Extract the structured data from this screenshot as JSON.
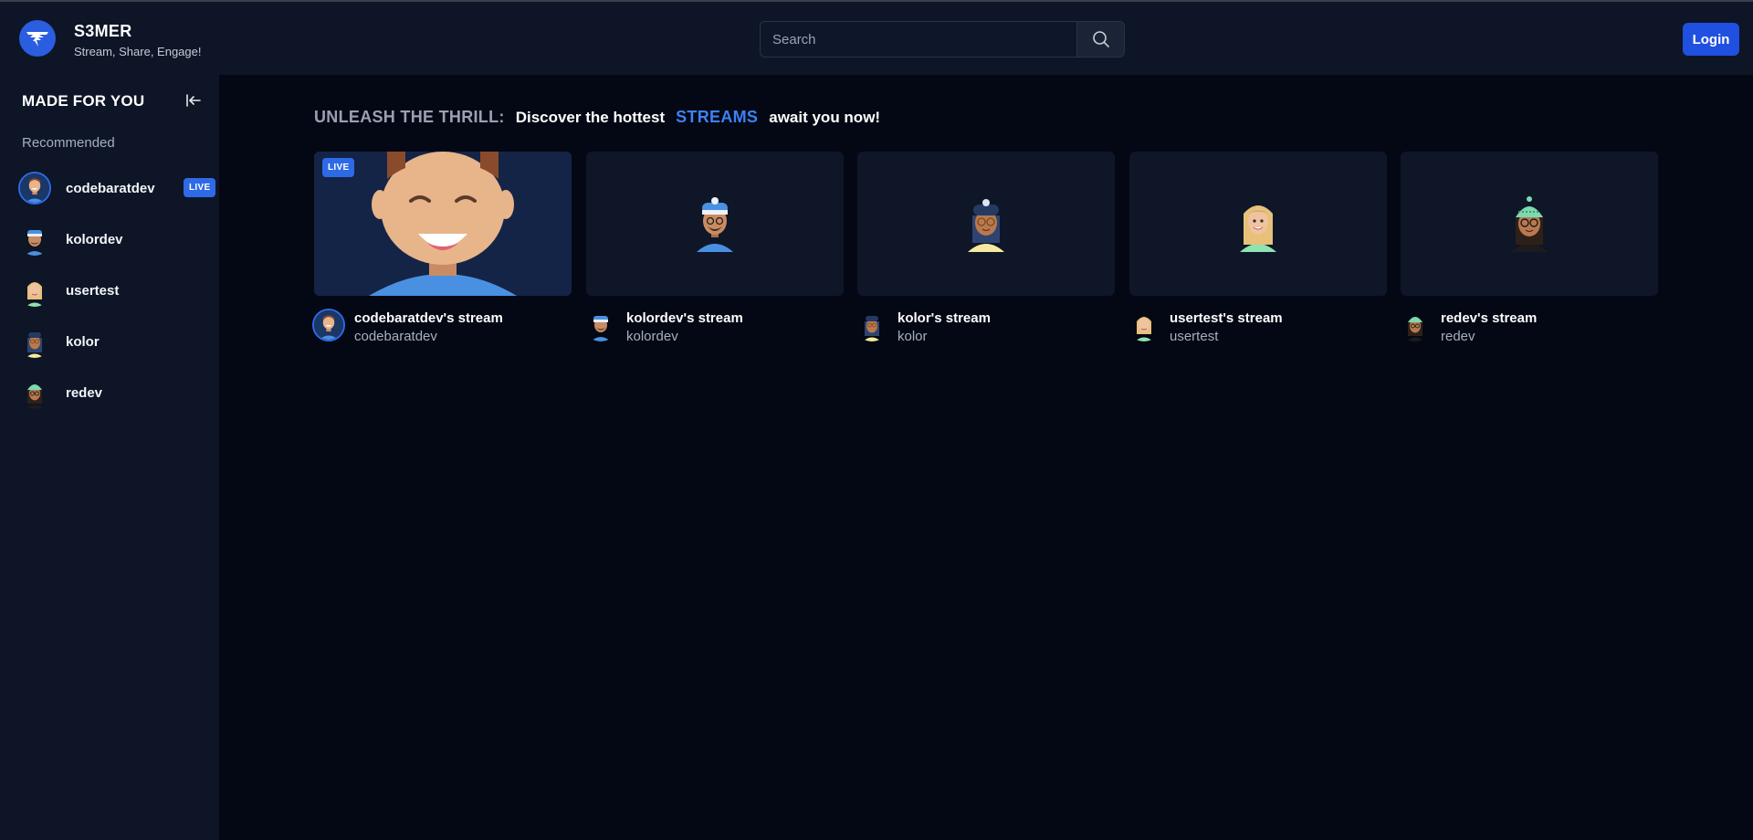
{
  "app": {
    "title": "S3MER",
    "tagline": "Stream, Share, Engage!"
  },
  "search": {
    "placeholder": "Search"
  },
  "header": {
    "login_label": "Login"
  },
  "sidebar": {
    "title": "MADE FOR YOU",
    "section_label": "Recommended",
    "live_badge": "LIVE",
    "items": [
      {
        "label": "codebaratdev",
        "live": true
      },
      {
        "label": "kolordev",
        "live": false
      },
      {
        "label": "usertest",
        "live": false
      },
      {
        "label": "kolor",
        "live": false
      },
      {
        "label": "redev",
        "live": false
      }
    ]
  },
  "hero": {
    "part1": "UNLEASH THE THRILL:",
    "part2": "Discover the hottest",
    "part3": "STREAMS",
    "part4": "await you now!"
  },
  "streams": [
    {
      "title": "codebaratdev's stream",
      "user": "codebaratdev",
      "live": true,
      "live_label": "LIVE"
    },
    {
      "title": "kolordev's stream",
      "user": "kolordev",
      "live": false
    },
    {
      "title": "kolor's stream",
      "user": "kolor",
      "live": false
    },
    {
      "title": "usertest's stream",
      "user": "usertest",
      "live": false
    },
    {
      "title": "redev's stream",
      "user": "redev",
      "live": false
    }
  ],
  "colors": {
    "accent": "#2f6ae6",
    "highlight": "#3b82f6",
    "background": "#030814",
    "panel": "#0d1526"
  }
}
